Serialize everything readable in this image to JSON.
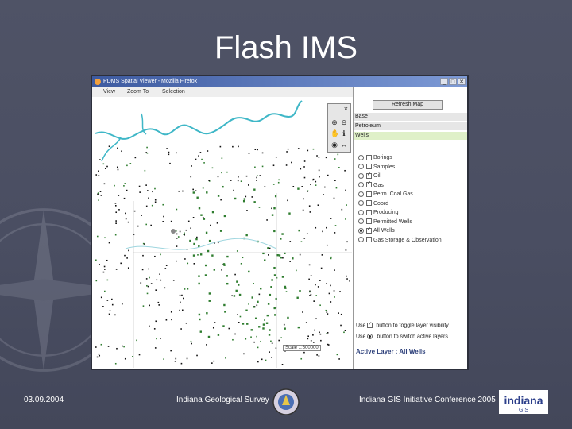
{
  "slide": {
    "title": "Flash IMS"
  },
  "footer": {
    "date": "03.09.2004",
    "center": "Indiana Geological Survey",
    "right": "Indiana GIS Initiative Conference 2005"
  },
  "window": {
    "title": "PDMS Spatial Viewer - Mozilla Firefox",
    "buttons": [
      "_",
      "□",
      "✕"
    ]
  },
  "menu": {
    "view": "View",
    "zoom": "Zoom To",
    "selection": "Selection"
  },
  "panel": {
    "refresh_label": "Refresh Map",
    "sections": [
      "Base",
      "Petroleum",
      "Wells"
    ],
    "layers": [
      {
        "label": "Borings",
        "checked": false
      },
      {
        "label": "Samples",
        "checked": false
      },
      {
        "label": "Oil",
        "checked": true
      },
      {
        "label": "Gas",
        "checked": true
      },
      {
        "label": "Perm. Coal Gas",
        "checked": false
      },
      {
        "label": "Coord",
        "checked": false
      },
      {
        "label": "Producing",
        "checked": false
      },
      {
        "label": "Permitted Wells",
        "checked": false
      },
      {
        "label": "All Wells",
        "checked": true
      },
      {
        "label": "Gas Storage & Observation",
        "checked": false
      }
    ],
    "active_radio_index": 8,
    "help_checkbox_pre": "Use",
    "help_checkbox_post": "button to toggle layer visibility",
    "help_radio_pre": "Use",
    "help_radio_post": "button to switch active layers",
    "active_layer": "Active Layer : All Wells"
  },
  "map": {
    "scale_label": "Scale 1:600000"
  },
  "colors": {
    "accent": "#3d5aa0",
    "wells_green": "#2f7d2f",
    "river": "#3fb7c7",
    "section_bg": "#e6e6e6",
    "wells_bg": "#dff0c8"
  }
}
